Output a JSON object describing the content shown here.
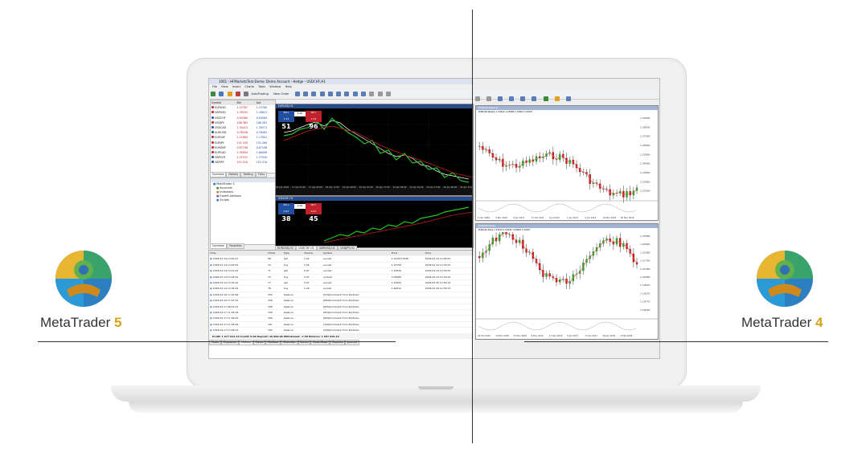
{
  "brand": {
    "left": {
      "name": "MetaTrader",
      "version": "5"
    },
    "right": {
      "name": "MetaTrader",
      "version": "4"
    },
    "accent": "#d6a21a"
  },
  "mt5": {
    "window_title": "1061 : HFMarketsTest-Demo: Demo Account - Hedge - USDCHF,H1",
    "menu": [
      "File",
      "View",
      "Insert",
      "Charts",
      "Tools",
      "Window",
      "Help"
    ],
    "toolbar": {
      "autotrading": "AutoTrading",
      "new_order": "New Order"
    },
    "market_watch": {
      "headers": [
        "Symbol",
        "Bid",
        "Ask"
      ],
      "rows": [
        {
          "symbol": "EURUSD",
          "bid": "1.23767",
          "ask": "1.23780"
        },
        {
          "symbol": "GBPUSD",
          "bid": "1.39593",
          "ask": "1.39611"
        },
        {
          "symbol": "USDCHF",
          "bid": "0.94560",
          "ask": "0.94564"
        },
        {
          "symbol": "USDJPY",
          "bid": "106.365",
          "ask": "106.381"
        },
        {
          "symbol": "USDCAD",
          "bid": "1.30415",
          "ask": "1.30571"
        },
        {
          "symbol": "AUDUSD",
          "bid": "0.78436",
          "ask": "0.78485"
        },
        {
          "symbol": "EURCHF",
          "bid": "1.15984",
          "ask": "1.17001"
        },
        {
          "symbol": "EURJPY",
          "bid": "131.345",
          "ask": "131.260"
        },
        {
          "symbol": "EURGBP",
          "bid": "0.87198",
          "ask": "0.87198"
        },
        {
          "symbol": "EURCAD",
          "bid": "1.59094",
          "ask": "1.60008"
        },
        {
          "symbol": "GBPCHF",
          "bid": "1.37532",
          "ask": "1.37550"
        },
        {
          "symbol": "GBPJPY",
          "bid": "152.310",
          "ask": "152.310"
        }
      ],
      "tabs": [
        "Symbols",
        "Details",
        "Trading",
        "Ticks"
      ]
    },
    "navigator": {
      "items": [
        "MetaTrader 5",
        "Accounts",
        "Indicators",
        "Expert Advisors",
        "Scripts"
      ],
      "tabs": [
        "Common",
        "Favorites"
      ]
    },
    "chart1": {
      "title": "EURUSD,H1",
      "sell_label": "SELL",
      "buy_label": "BUY",
      "lot": "1.00",
      "sell_price": "51",
      "buy_price": "96",
      "sell_prefix": "1.23",
      "buy_prefix": "1.23",
      "dates": [
        "16 Apr 2018",
        "17 Apr 01:00",
        "17 Apr 09:00",
        "18 Apr 17:00",
        "19 Apr 09:00",
        "20 Apr 01:00",
        "20 Apr 17:00",
        "23 Apr 09:00",
        "24 Apr 01:00",
        "24 Apr 17:00",
        "25 Apr 09:00",
        "26 Apr 01:00"
      ]
    },
    "chart2": {
      "title": "USDCHF,H1",
      "sell_label": "SELL",
      "buy_label": "BUY",
      "lot": "1.00",
      "sell_price": "38",
      "buy_price": "45",
      "sell_prefix": "0.97",
      "buy_prefix": "0.97"
    },
    "chart_tabs": [
      "EURUSD,H1",
      "USDCHF,H1",
      "GBPUSD,H1",
      "USDJPY,H1"
    ],
    "terminal": {
      "headers": [
        "Time",
        "Ticket",
        "Type",
        "Volume",
        "Symbol",
        "Price",
        "Time"
      ],
      "rows": [
        {
          "time": "2018.03.14 13:00:27",
          "ticket": "68",
          "type": "sell",
          "volume": "1.02",
          "symbol": "eurusd",
          "price": "1.23767/1648",
          "time2": "2018.03.14 13:09:53"
        },
        {
          "time": "2018.03.14 13:09:53",
          "ticket": "70",
          "type": "buy",
          "volume": "1.05",
          "symbol": "eurusd",
          "price": "1.23753",
          "time2": "2018.03.14 13:33:25"
        },
        {
          "time": "2018.03.14 13:10:01",
          "ticket": "71",
          "type": "sell",
          "volume": "0.97",
          "symbol": "eurusd",
          "price": "1.23810",
          "time2": "2018.03.14 13:33:25"
        },
        {
          "time": "2018.03.14 13:28:41",
          "ticket": "73",
          "type": "buy",
          "volume": "0.97",
          "symbol": "audusd",
          "price": "0.78082",
          "time2": "2018.03.14 13:33:24"
        },
        {
          "time": "2018.03.14 13:33:21",
          "ticket": "77",
          "type": "sell",
          "volume": "0.97",
          "symbol": "eurusd",
          "price": "1.23931",
          "time2": "2018.03.30 12:50:13"
        },
        {
          "time": "2018.03.14 13:39:22",
          "ticket": "78",
          "type": "buy",
          "volume": "1.26",
          "symbol": "eurcad",
          "price": "1.60012",
          "time2": "2018.03.30 12:50:13"
        },
        {
          "time": "2018.04.16 17:25:46",
          "ticket": "335",
          "type": "balance",
          "volume": "",
          "symbol": "[579]Comment from Postman",
          "price": "",
          "time2": ""
        },
        {
          "time": "2018.04.16 17:25:51",
          "ticket": "336",
          "type": "balance",
          "volume": "",
          "symbol": "[669]Comment from Postman",
          "price": "",
          "time2": ""
        },
        {
          "time": "2018.04.17 08:20:12",
          "ticket": "338",
          "type": "balance",
          "volume": "",
          "symbol": "[825]Comment from Postman",
          "price": "",
          "time2": ""
        },
        {
          "time": "2018.04.17 11:06:18",
          "ticket": "339",
          "type": "balance",
          "volume": "",
          "symbol": "[834]Comment from Postman",
          "price": "",
          "time2": ""
        },
        {
          "time": "2018.04.17 11:06:23",
          "ticket": "340",
          "type": "balance",
          "volume": "",
          "symbol": "[844]Comment from Postman",
          "price": "",
          "time2": ""
        },
        {
          "time": "2018.04.17 11:06:28",
          "ticket": "341",
          "type": "balance",
          "volume": "",
          "symbol": "[149]Comment from Postman",
          "price": "",
          "time2": ""
        },
        {
          "time": "2018.04.17 13:06:14",
          "ticket": "342",
          "type": "balance",
          "volume": "",
          "symbol": "[226]Comment from Postman",
          "price": "",
          "time2": ""
        }
      ],
      "summary": "Profit: 1 677 012.16  Credit: 0.00  Deposit: 10 000.00  Withdrawal: -7.50  Balance: 1 667 019.16",
      "tabs": [
        "Trade",
        "Exposure",
        "History",
        "News",
        "Mailbox",
        "Calendar",
        "Alerts",
        "Code Base",
        "Experts",
        "Journal"
      ]
    }
  },
  "mt4": {
    "chart1": {
      "title": "EURUSD,Weekly",
      "info": "EURUSD,Weekly 1.23022 1.23048 1.22902 1.22937",
      "prices": [
        "1.30060",
        "1.28900",
        "1.27560",
        "1.26690",
        "1.25900",
        "1.24560",
        "1.23690",
        "1.22860",
        "1.22000"
      ],
      "dates": [
        "1 Dec 2009",
        "9 Nov 2010",
        "8 Jun 2011",
        "11 Oct 2011",
        "9 Jul 2012",
        "1 Jan 2013",
        "9 Jun 2014",
        "16 Nov 2015",
        "26 Nov 2016"
      ]
    },
    "chart2": {
      "title": "EURUSD,Daily",
      "info": "EURUSD,Daily 1.23419 1.23504 1.22803 1.23207",
      "prices": [
        "1.23580",
        "1.22990",
        "1.22380",
        "1.21790",
        "1.21180",
        "1.20580",
        "1.19970",
        "1.19370",
        "1.18770",
        "1.18160"
      ],
      "dates": [
        "24 Oct 2016",
        "13 Nov 2016",
        "27 Nov 2016",
        "8 Dec 2016",
        "17 Dec 2016",
        "5 Jan 2017",
        "17 Jan 2017",
        "29 Jan 2018",
        "9 Feb 2018"
      ]
    }
  }
}
